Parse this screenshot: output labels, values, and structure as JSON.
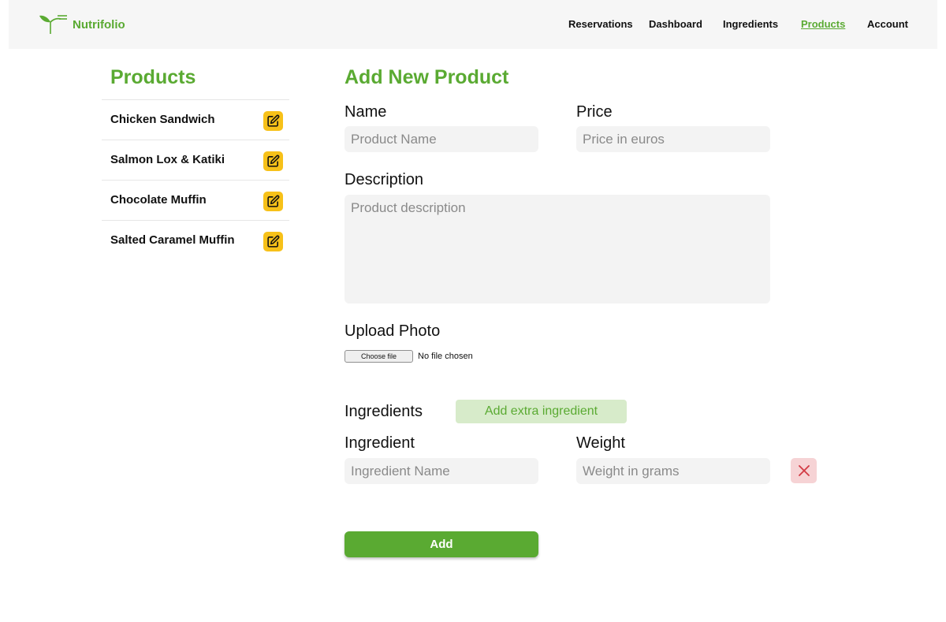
{
  "brand": {
    "name": "Nutrifolio",
    "logo_icon": "leaf-logo-icon"
  },
  "nav": {
    "items": [
      {
        "label": "Reservations"
      },
      {
        "label": "Dashboard"
      },
      {
        "label": "Ingredients"
      },
      {
        "label": "Products",
        "active": true
      },
      {
        "label": "Account"
      }
    ]
  },
  "sidebar": {
    "title": "Products",
    "items": [
      {
        "label": "Chicken Sandwich",
        "icon": "edit-icon"
      },
      {
        "label": "Salmon Lox & Katiki",
        "icon": "edit-icon"
      },
      {
        "label": "Chocolate Muffin",
        "icon": "edit-icon"
      },
      {
        "label": "Salted Caramel Muffin",
        "icon": "edit-icon"
      }
    ]
  },
  "form": {
    "title": "Add New Product",
    "name": {
      "label": "Name",
      "placeholder": "Product Name",
      "value": ""
    },
    "price": {
      "label": "Price",
      "placeholder": "Price in euros",
      "value": ""
    },
    "description": {
      "label": "Description",
      "placeholder": "Product description",
      "value": ""
    },
    "upload": {
      "label": "Upload Photo",
      "button_label": "Choose file",
      "status": "No file chosen"
    },
    "ingredients": {
      "label": "Ingredients",
      "add_extra_label": "Add extra ingredient",
      "rows": [
        {
          "ingredient_label": "Ingredient",
          "ingredient_placeholder": "Ingredient Name",
          "weight_label": "Weight",
          "weight_placeholder": "Weight in grams",
          "remove_icon": "close-icon"
        }
      ]
    },
    "submit_label": "Add"
  },
  "colors": {
    "accent_green": "#5aaa32",
    "light_green": "#d7ebca",
    "edit_yellow": "#f7c119",
    "remove_pink": "#f6d3d5",
    "remove_red": "#d23a44",
    "field_bg": "#f3f3f3",
    "nav_bg": "#f6f6f6"
  }
}
